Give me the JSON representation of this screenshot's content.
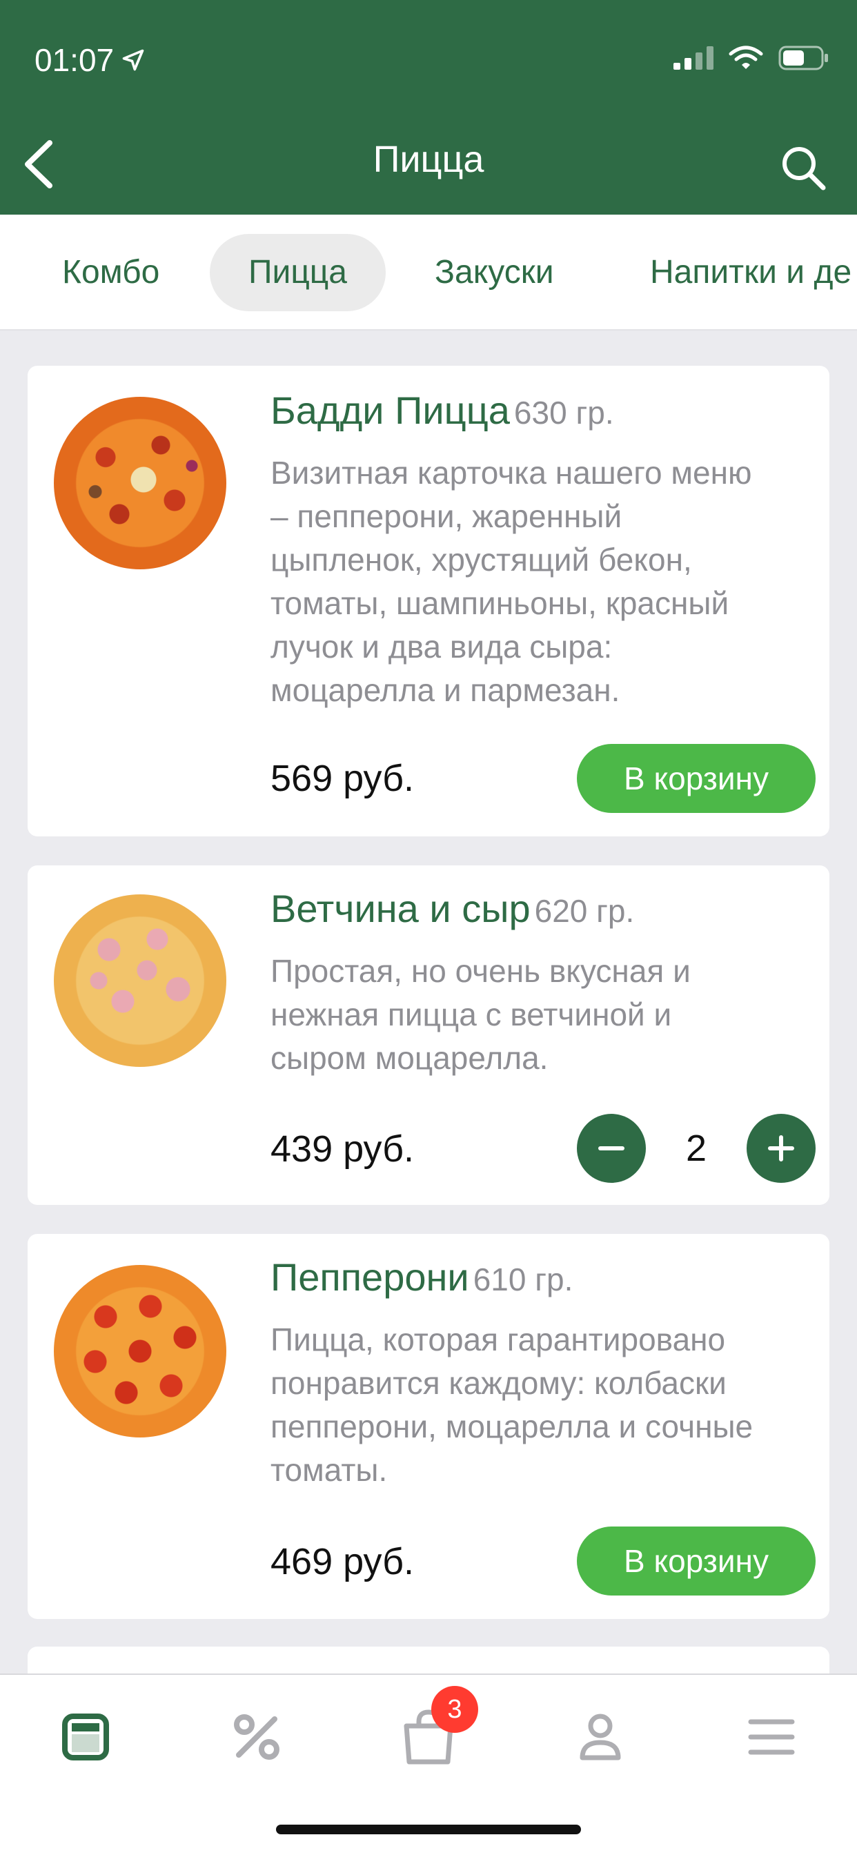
{
  "status": {
    "time": "01:07",
    "location_icon": "location-arrow-icon",
    "signal_icon": "signal-icon",
    "wifi_icon": "wifi-icon",
    "battery_icon": "battery-icon"
  },
  "nav": {
    "title": "Пицца",
    "back_icon": "chevron-left-icon",
    "search_icon": "search-icon"
  },
  "categories": [
    {
      "label": "Комбо",
      "active": false
    },
    {
      "label": "Пицца",
      "active": true
    },
    {
      "label": "Закуски",
      "active": false
    },
    {
      "label": "Напитки и де",
      "active": false
    }
  ],
  "products": [
    {
      "name": "Бадди Пицца",
      "weight": "630 гр.",
      "desc_lines": [
        "Визитная карточка нашего меню",
        "– пепперони, жаренный",
        "цыпленок, хрустящий бекон,",
        "томаты, шампиньоны, красный",
        "лучок и два вида сыра:",
        "моцарелла и пармезан."
      ],
      "price": "569 руб.",
      "cart_label": "В корзину"
    },
    {
      "name": "Ветчина и сыр",
      "weight": "620 гр.",
      "desc_lines": [
        "Простая, но очень вкусная и",
        "нежная пицца с ветчиной и",
        "сыром моцарелла."
      ],
      "price": "439 руб.",
      "quantity": "2"
    },
    {
      "name": "Пепперони",
      "weight": "610 гр.",
      "desc_lines": [
        "Пицца, которая гарантировано",
        "понравится каждому: колбаски",
        "пепперони, моцарелла и сочные",
        "томаты."
      ],
      "price": "469 руб.",
      "cart_label": "В корзину"
    }
  ],
  "tabbar": {
    "items": [
      "menu-icon",
      "percent-icon",
      "cart-icon",
      "profile-icon",
      "hamburger-icon"
    ],
    "cart_badge": "3"
  },
  "colors": {
    "brand": "#2e6b45",
    "button": "#4cb848",
    "badge": "#ff3b30"
  }
}
